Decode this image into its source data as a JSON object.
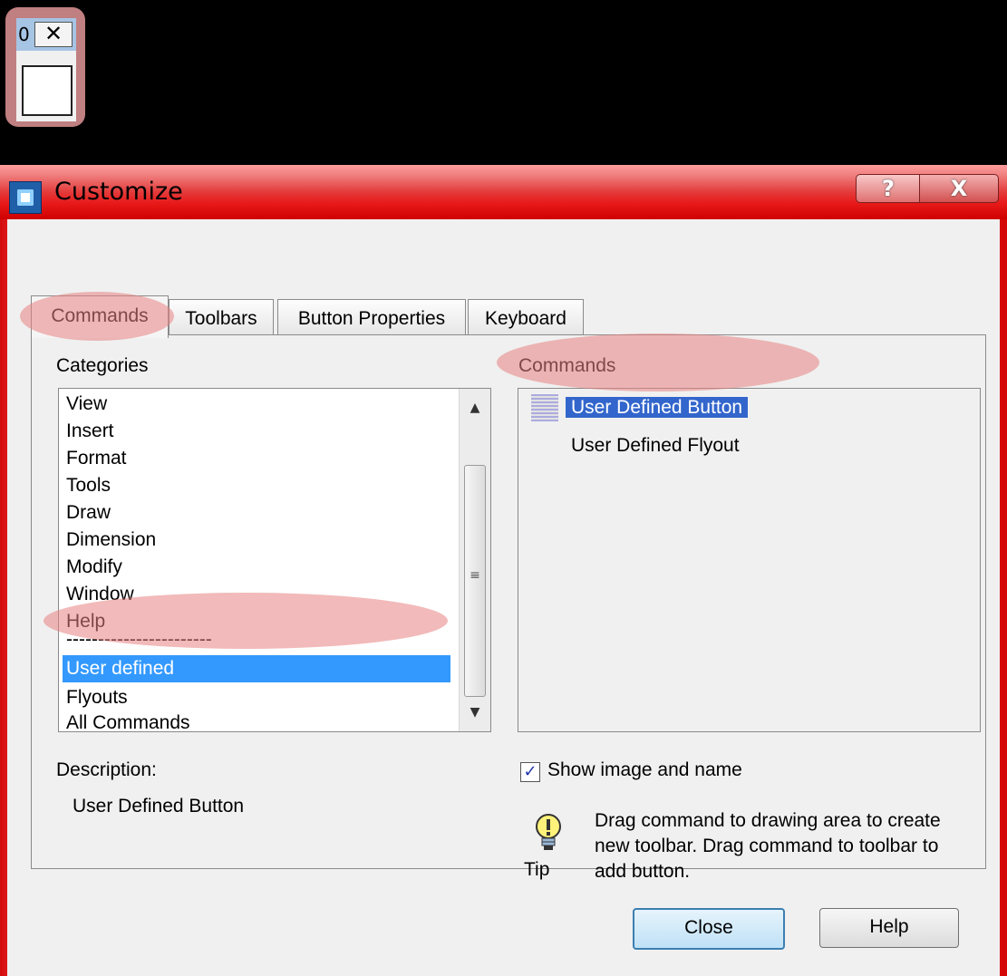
{
  "mini_toolbar": {
    "title_fragment": "0",
    "close_glyph": "✕"
  },
  "window": {
    "title": "Customize",
    "help_glyph": "?",
    "close_glyph": "X"
  },
  "tabs": [
    {
      "label": "Commands",
      "active": true
    },
    {
      "label": "Toolbars",
      "active": false
    },
    {
      "label": "Button Properties",
      "active": false
    },
    {
      "label": "Keyboard",
      "active": false
    }
  ],
  "categories": {
    "label": "Categories",
    "items": [
      "View",
      "Insert",
      "Format",
      "Tools",
      "Draw",
      "Dimension",
      "Modify",
      "Window",
      "Help",
      "-----------------------",
      "User defined",
      "Flyouts",
      "All Commands"
    ],
    "selected": "User defined"
  },
  "commands": {
    "label": "Commands",
    "items": [
      "User Defined Button",
      "User Defined Flyout"
    ],
    "selected": "User Defined Button"
  },
  "description": {
    "label": "Description:",
    "value": "User Defined Button"
  },
  "show_image_and_name": {
    "label": "Show image and name",
    "checked": true
  },
  "tip": {
    "label": "Tip",
    "text": "Drag command to drawing area to create new toolbar. Drag command to toolbar to add button."
  },
  "buttons": {
    "close": "Close",
    "help": "Help"
  },
  "colors": {
    "frame_red": "#e30b0b",
    "selection_blue": "#3399ff",
    "annotation_oval": "#e88282"
  }
}
